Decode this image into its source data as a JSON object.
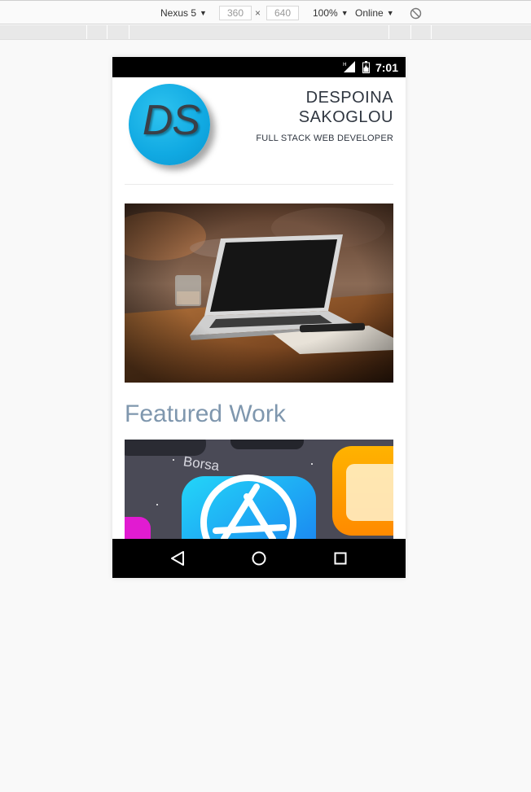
{
  "devtools": {
    "device": "Nexus 5",
    "width": "360",
    "times": "×",
    "height": "640",
    "zoom": "100%",
    "network": "Online",
    "rotate_icon": "rotate-icon"
  },
  "statusbar": {
    "time": "7:01",
    "signal_icon": "signal-icon",
    "battery_icon": "battery-icon"
  },
  "header": {
    "logo_text": "DS",
    "name": "DESPOINA SAKOGLOU",
    "subtitle": "FULL STACK WEB DEVELOPER"
  },
  "featured": {
    "title": "Featured Work"
  },
  "navbar": {
    "back_icon": "back-icon",
    "home_icon": "home-icon",
    "recents_icon": "recents-icon"
  },
  "colors": {
    "logo_blue": "#10a9e2",
    "heading_blue_grey": "#7f97ae",
    "text_dark": "#2f3640"
  }
}
